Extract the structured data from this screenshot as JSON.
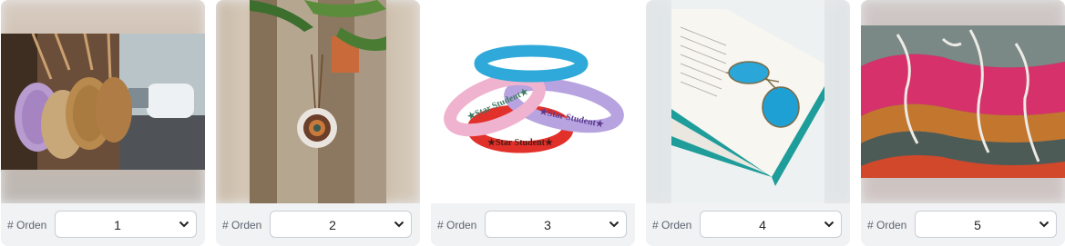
{
  "order_label": "# Orden",
  "items": [
    {
      "value": "1",
      "image": "round-rattan-bags-photo"
    },
    {
      "value": "2",
      "image": "wooden-door-pendant-photo"
    },
    {
      "value": "3",
      "image": "star-student-wristbands-photo"
    },
    {
      "value": "4",
      "image": "book-and-sunglasses-photo"
    },
    {
      "value": "5",
      "image": "knitted-yarn-pile-photo"
    }
  ],
  "wristband_text": "★Star Student★",
  "colors": {
    "card_bg": "#f1f2f4",
    "select_border": "#c9ced6",
    "label_text": "#5b6470"
  }
}
